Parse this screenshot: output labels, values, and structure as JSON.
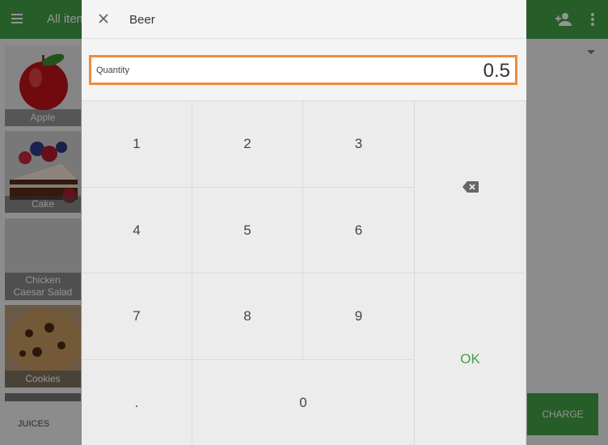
{
  "background": {
    "title": "All items",
    "tiles": [
      "Apple",
      "Cake",
      "Chicken Caesar Salad",
      "Cookies"
    ],
    "tab_label": "JUICES",
    "charge_label": "CHARGE",
    "colors": {
      "toolbar": "#43a047",
      "accent": "#43a047"
    }
  },
  "dialog": {
    "title": "Beer",
    "close_icon": "close-icon",
    "quantity_label": "Quantity",
    "quantity_value": "0.5",
    "field_border_color": "#f08c3c",
    "keys": {
      "k1": "1",
      "k2": "2",
      "k3": "3",
      "k4": "4",
      "k5": "5",
      "k6": "6",
      "k7": "7",
      "k8": "8",
      "k9": "9",
      "dot": ".",
      "k0": "0",
      "backspace_icon": "backspace-icon",
      "ok": "OK"
    },
    "ok_color": "#43a047"
  }
}
